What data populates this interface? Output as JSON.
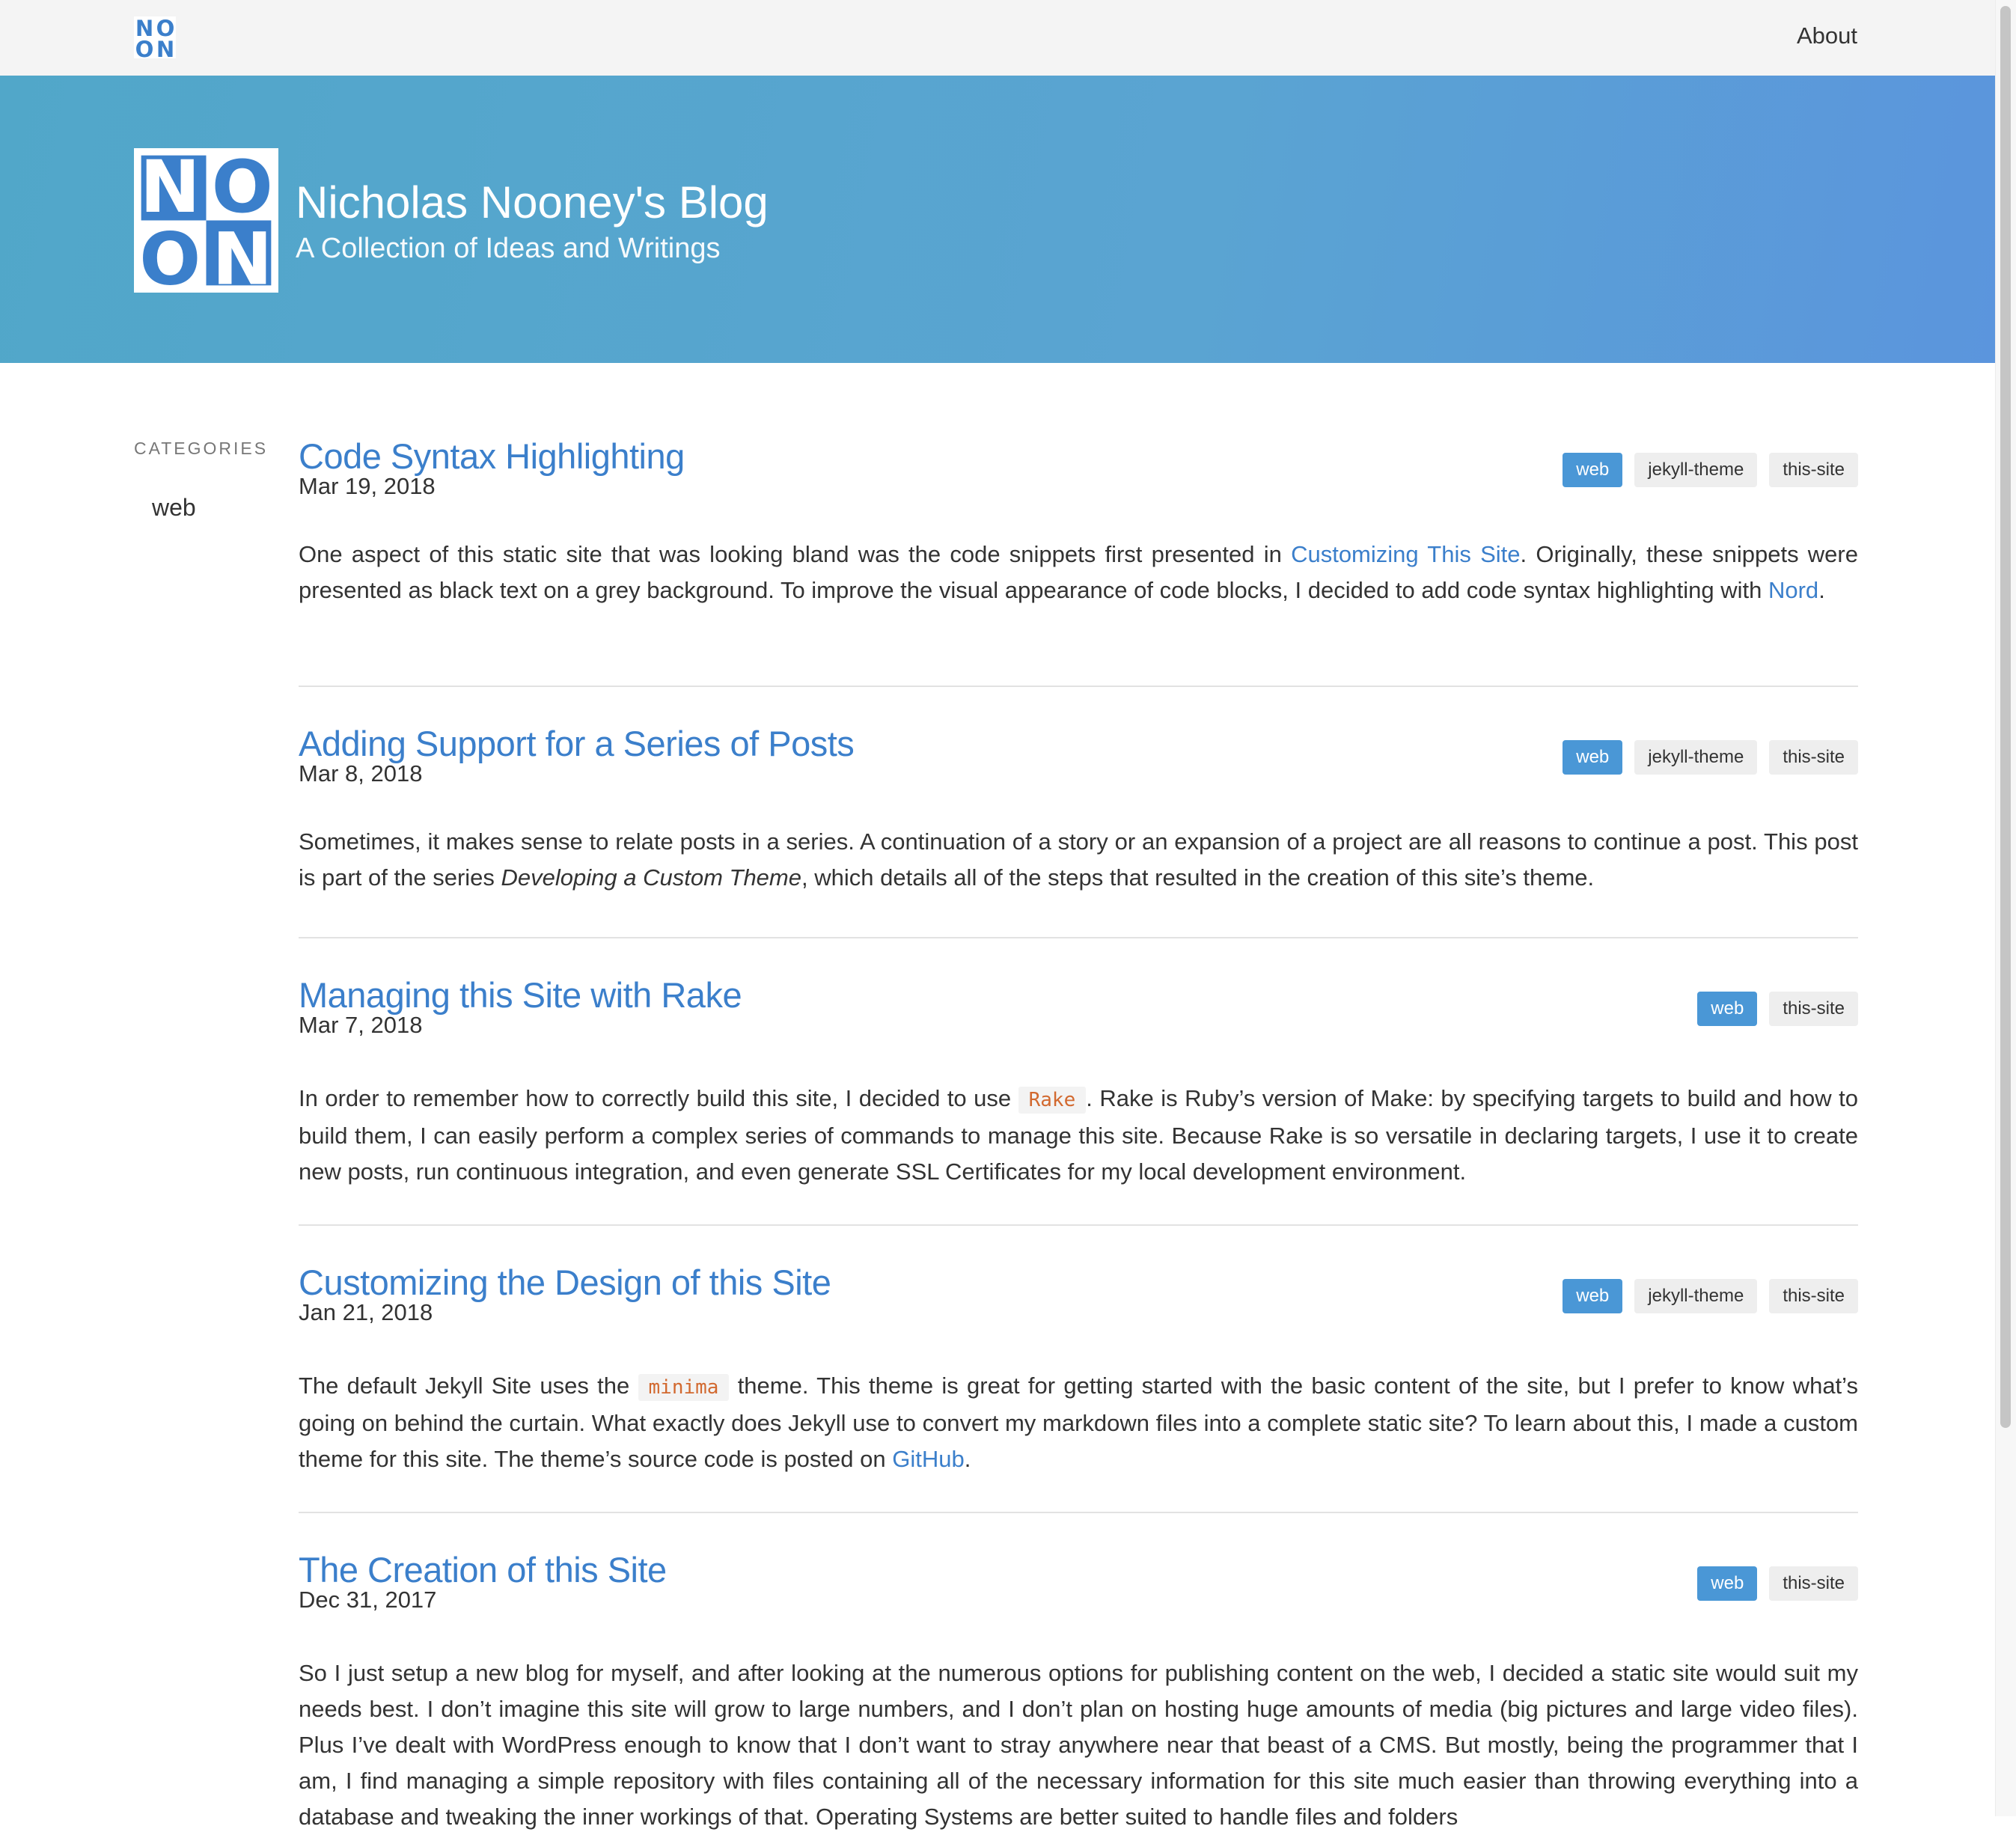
{
  "nav": {
    "about_label": "About",
    "logo_letters": [
      "N",
      "O",
      "O",
      "N"
    ]
  },
  "hero": {
    "title": "Nicholas Nooney's Blog",
    "subtitle": "A Collection of Ideas and Writings"
  },
  "sidebar": {
    "heading": "CATEGORIES",
    "items": [
      "web"
    ]
  },
  "posts": [
    {
      "title": "Code Syntax Highlighting",
      "date": "Mar 19, 2018",
      "tags": [
        "web",
        "jekyll-theme",
        "this-site"
      ],
      "excerpt": {
        "p1": "One aspect of this static site that was looking bland was the code snippets first presented in ",
        "link1": "Customizing This Site",
        "p2": ". Originally, these snippets were presented as black text on a grey background. To improve the visual appearance of code blocks, I decided to add code syntax highlighting with ",
        "link2": "Nord",
        "p3": "."
      }
    },
    {
      "title": "Adding Support for a Series of Posts",
      "date": "Mar 8, 2018",
      "tags": [
        "web",
        "jekyll-theme",
        "this-site"
      ],
      "excerpt": {
        "p1": "Sometimes, it makes sense to relate posts in a series. A continuation of a story or an expansion of a project are all reasons to continue a post. This post is part of the series ",
        "em": "Developing a Custom Theme",
        "p2": ", which details all of the steps that resulted in the creation of this site’s theme."
      }
    },
    {
      "title": "Managing this Site with Rake",
      "date": "Mar 7, 2018",
      "tags": [
        "web",
        "this-site"
      ],
      "excerpt": {
        "p1": "In order to remember how to correctly build this site, I decided to use ",
        "code": "Rake",
        "p2": ". Rake is Ruby’s version of Make: by specifying targets to build and how to build them, I can easily perform a complex series of commands to manage this site. Because Rake is so versatile in declaring targets, I use it to create new posts, run continuous integration, and even generate SSL Certificates for my local development environment."
      }
    },
    {
      "title": "Customizing the Design of this Site",
      "date": "Jan 21, 2018",
      "tags": [
        "web",
        "jekyll-theme",
        "this-site"
      ],
      "excerpt": {
        "p1": "The default Jekyll Site uses the ",
        "code": "minima",
        "p2": " theme. This theme is great for getting started with the basic content of the site, but I prefer to know what’s going on behind the curtain. What exactly does Jekyll use to convert my markdown files into a complete static site? To learn about this, I made a custom theme for this site. The theme’s source code is posted on ",
        "link1": "GitHub",
        "p3": "."
      }
    },
    {
      "title": "The Creation of this Site",
      "date": "Dec 31, 2017",
      "tags": [
        "web",
        "this-site"
      ],
      "excerpt": {
        "p1": "So I just setup a new blog for myself, and after looking at the numerous options for publishing content on the web, I decided a static site would suit my needs best. I don’t imagine this site will grow to large numbers, and I don’t plan on hosting huge amounts of media (big pictures and large video files). Plus I’ve dealt with WordPress enough to know that I don’t want to stray anywhere near that beast of a CMS. But mostly, being the programmer that I am, I find managing a simple repository with files containing all of the necessary information for this site much easier than throwing everything into a database and tweaking the inner workings of that. Operating Systems are better suited to handle files and folders"
      }
    }
  ],
  "colors": {
    "accent": "#3b7fcb",
    "tag_primary": "#4a97d6",
    "code": "#d2692f",
    "logo_blue": "#3b7fcb"
  }
}
